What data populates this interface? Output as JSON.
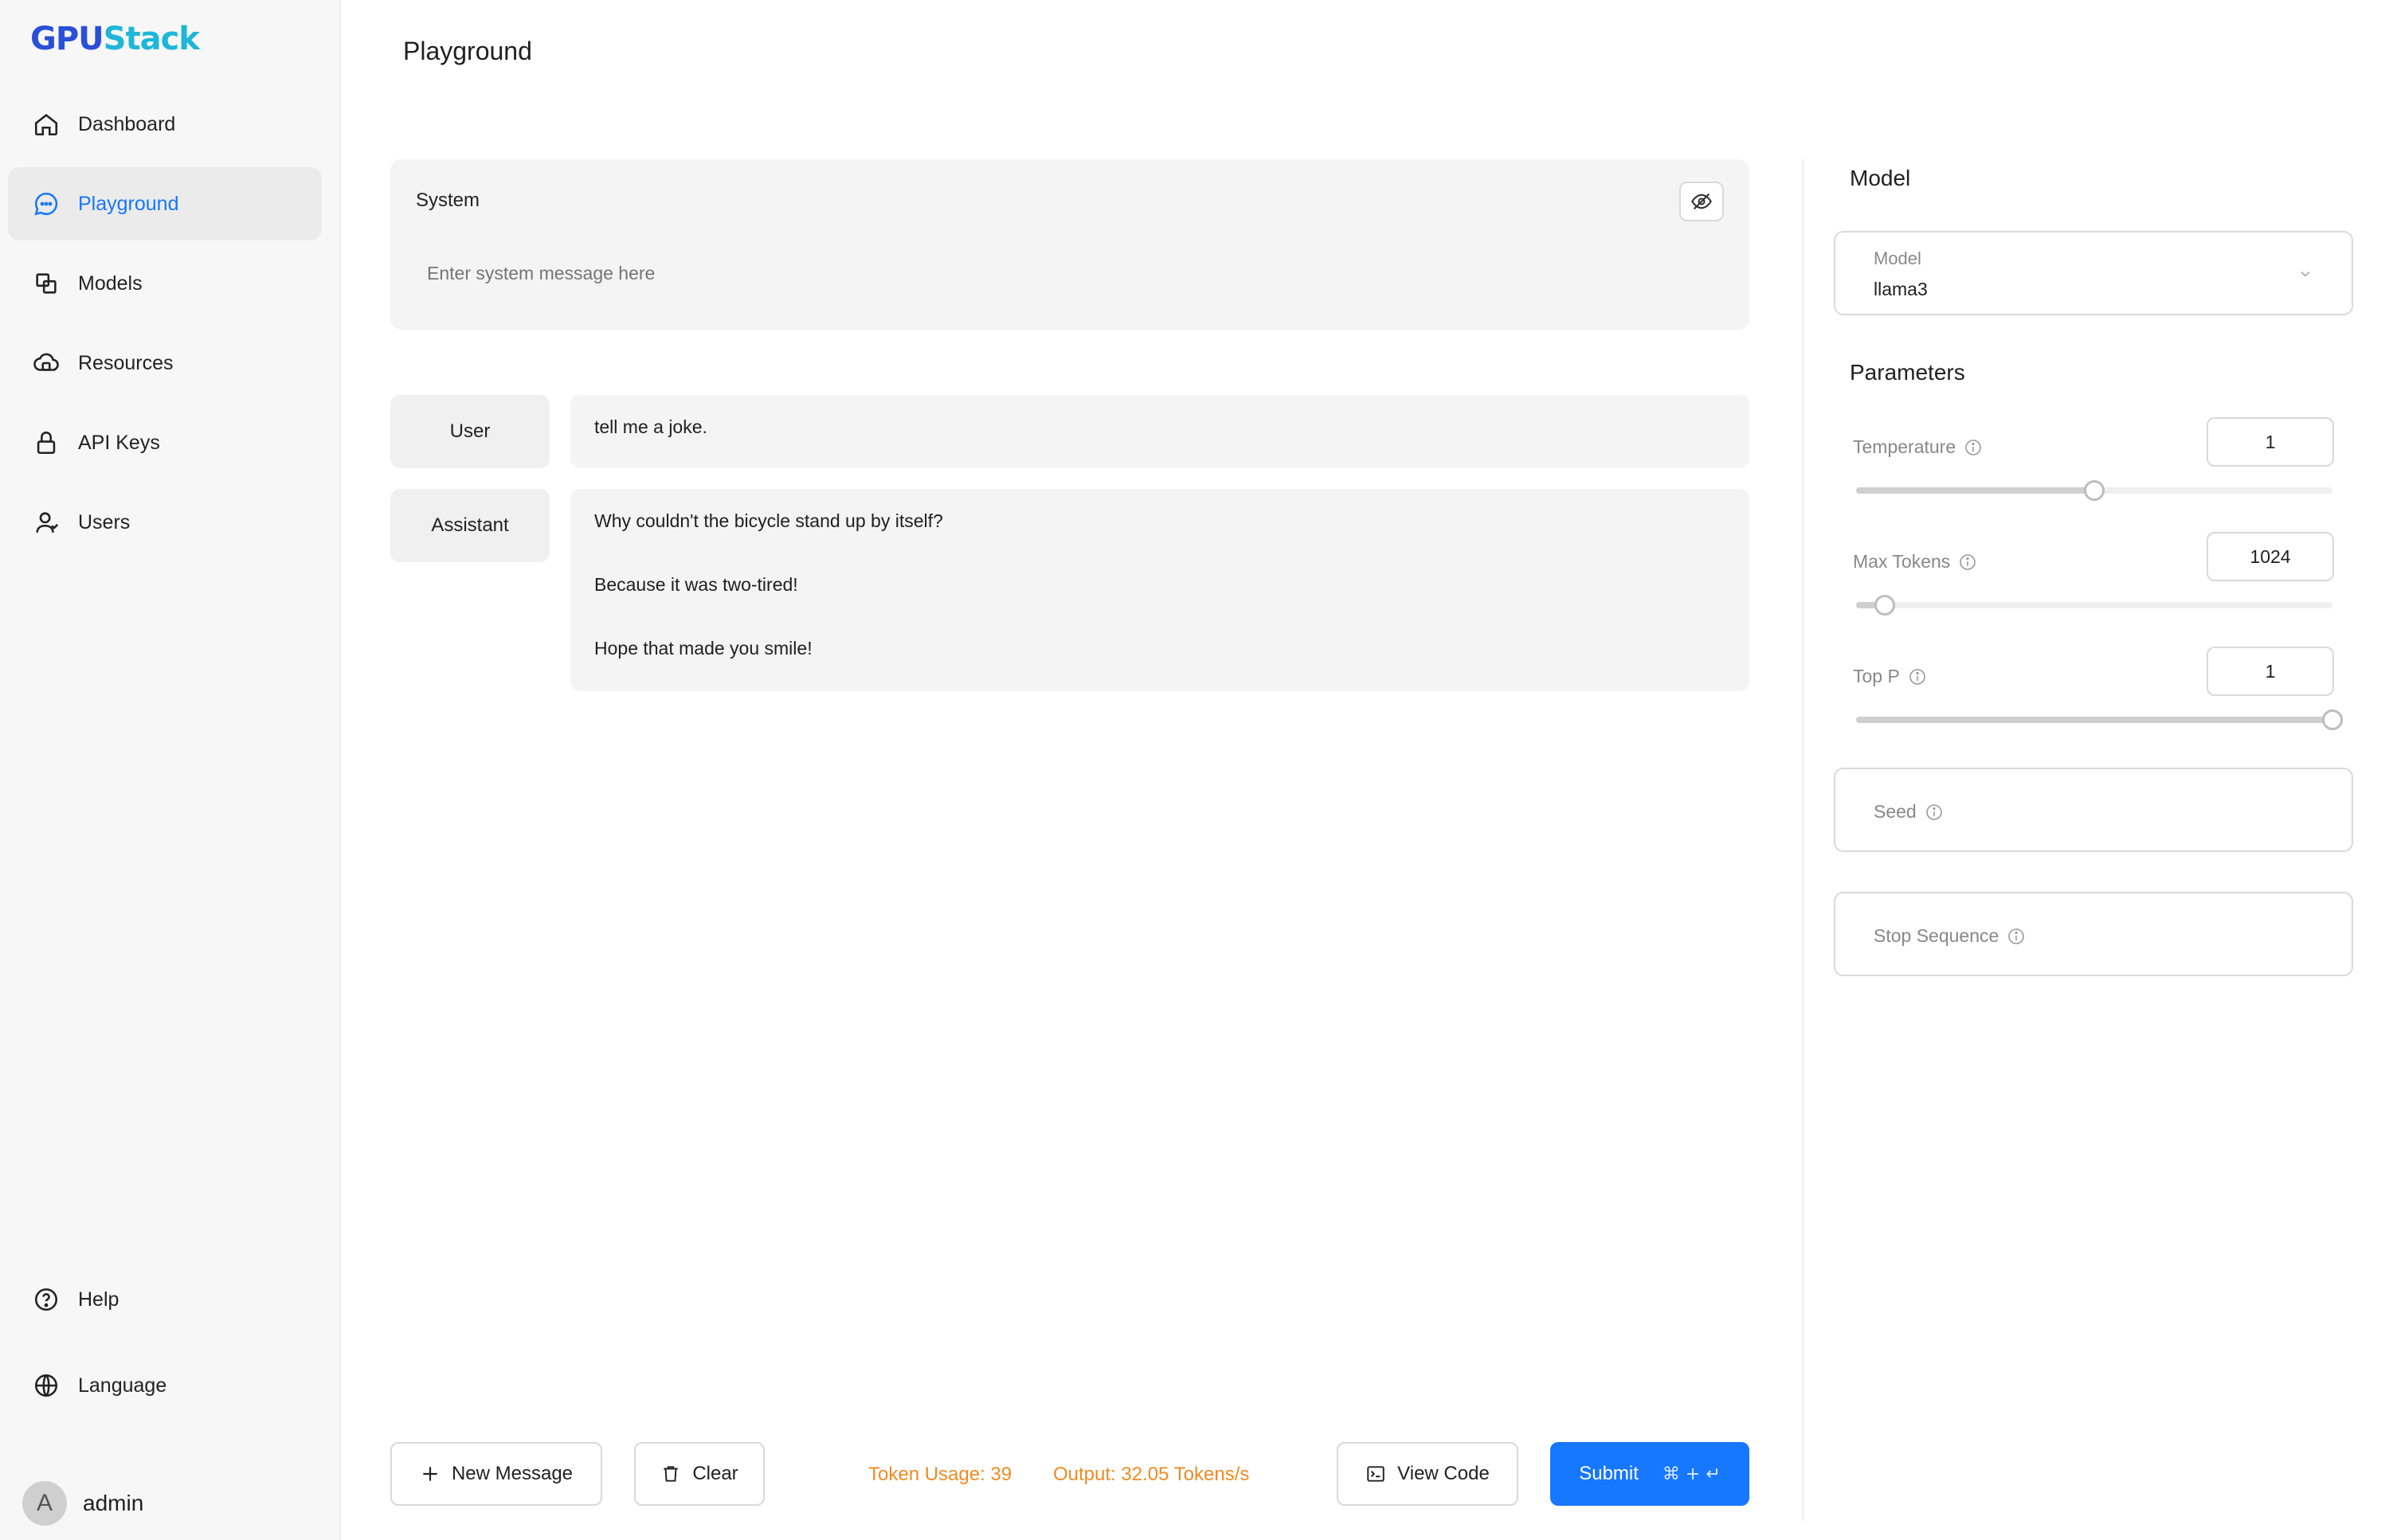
{
  "brand": {
    "logo_prefix": "G",
    "logo_mid": "PU",
    "logo_suffix": "Stack"
  },
  "sidebar": {
    "items": [
      {
        "label": "Dashboard",
        "icon": "home-icon"
      },
      {
        "label": "Playground",
        "icon": "chat-icon",
        "active": true
      },
      {
        "label": "Models",
        "icon": "models-icon"
      },
      {
        "label": "Resources",
        "icon": "cloud-icon"
      },
      {
        "label": "API Keys",
        "icon": "lock-icon"
      },
      {
        "label": "Users",
        "icon": "users-icon"
      }
    ],
    "help_label": "Help",
    "language_label": "Language",
    "user": {
      "initial": "A",
      "name": "admin"
    }
  },
  "page": {
    "title": "Playground"
  },
  "system": {
    "label": "System",
    "placeholder": "Enter system message here"
  },
  "messages": [
    {
      "role": "User",
      "content": [
        "tell me a joke."
      ]
    },
    {
      "role": "Assistant",
      "content": [
        "Why couldn't the bicycle stand up by itself?",
        "Because it was two-tired!",
        "Hope that made you smile!"
      ]
    }
  ],
  "footer": {
    "new_message": "New Message",
    "clear": "Clear",
    "token_usage": "Token Usage: 39",
    "output": "Output: 32.05 Tokens/s",
    "view_code": "View Code",
    "submit": "Submit",
    "submit_keys": "⌘ + ↵"
  },
  "right_panel": {
    "model_section": "Model",
    "model_field_label": "Model",
    "model_value": "llama3",
    "parameters_section": "Parameters",
    "params": [
      {
        "label": "Temperature",
        "value": "1",
        "fraction": 0.5
      },
      {
        "label": "Max Tokens",
        "value": "1024",
        "fraction": 0.06
      },
      {
        "label": "Top P",
        "value": "1",
        "fraction": 1.0
      }
    ],
    "seed_placeholder": "Seed",
    "stop_placeholder": "Stop Sequence"
  },
  "colors": {
    "accent": "#1677ff",
    "stat": "#f08a24"
  }
}
